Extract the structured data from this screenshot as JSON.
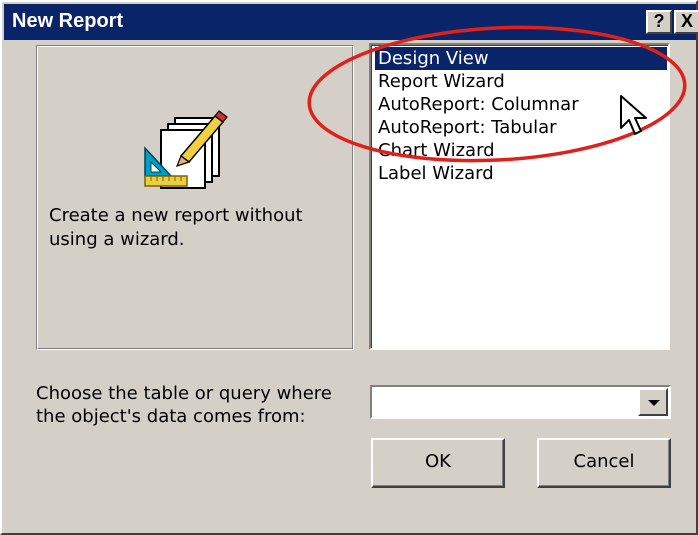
{
  "window": {
    "title": "New Report",
    "help_label": "?",
    "close_label": "X"
  },
  "preview": {
    "icon": "report-design-icon",
    "description": "Create a new report without using a wizard."
  },
  "report_types": {
    "items": [
      {
        "label": "Design View",
        "selected": true
      },
      {
        "label": "Report Wizard",
        "selected": false
      },
      {
        "label": "AutoReport: Columnar",
        "selected": false
      },
      {
        "label": "AutoReport: Tabular",
        "selected": false
      },
      {
        "label": "Chart Wizard",
        "selected": false
      },
      {
        "label": "Label Wizard",
        "selected": false
      }
    ]
  },
  "source": {
    "label": "Choose the table or query where the object's data comes from:",
    "value": ""
  },
  "buttons": {
    "ok": "OK",
    "cancel": "Cancel"
  },
  "colors": {
    "selection": "#0a246a",
    "annotation": "#e0201b",
    "dialog_face": "#d4d0c8"
  }
}
